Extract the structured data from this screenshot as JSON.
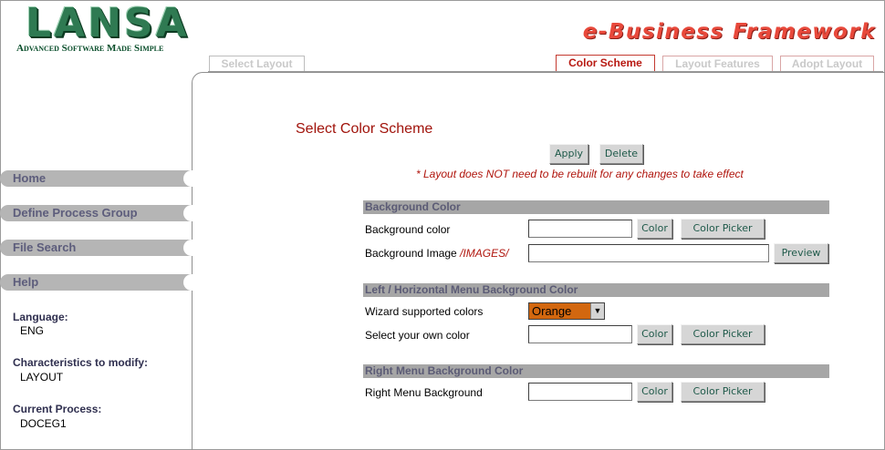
{
  "header": {
    "logo_text": "LANSA",
    "logo_tagline": "Advanced Software Made Simple",
    "framework_title": "e-Business Framework"
  },
  "tabs": [
    {
      "label": "Select Layout",
      "active": false
    },
    {
      "label": "Color Scheme",
      "active": true
    },
    {
      "label": "Layout Features",
      "active": false
    },
    {
      "label": "Adopt Layout",
      "active": false
    }
  ],
  "sidebar": {
    "nav": [
      "Home",
      "Define Process Group",
      "File Search",
      "Help"
    ],
    "info": [
      {
        "label": "Language:",
        "value": "ENG"
      },
      {
        "label": "Characteristics to modify:",
        "value": "LAYOUT"
      },
      {
        "label": "Current Process:",
        "value": "DOCEG1"
      }
    ]
  },
  "main": {
    "title": "Select Color Scheme",
    "apply_label": "Apply",
    "delete_label": "Delete",
    "note": "* Layout does NOT need to be rebuilt for any changes to take effect",
    "sections": [
      {
        "title": "Background Color",
        "rows": [
          {
            "label": "Background color",
            "value": "",
            "buttons": [
              "Color",
              "Color Picker"
            ]
          },
          {
            "label": "Background Image",
            "path": "/IMAGES/",
            "value": "",
            "buttons": [
              "Preview"
            ]
          }
        ]
      },
      {
        "title": "Left / Horizontal Menu Background Color",
        "rows": [
          {
            "label": "Wizard supported colors",
            "selected": "Orange"
          },
          {
            "label": "Select your own color",
            "value": "",
            "buttons": [
              "Color",
              "Color Picker"
            ]
          }
        ]
      },
      {
        "title": "Right Menu Background Color",
        "rows": [
          {
            "label": "Right Menu Background",
            "value": "",
            "buttons": [
              "Color",
              "Color Picker"
            ]
          }
        ]
      }
    ]
  },
  "colors": {
    "accent_red": "#b0150d",
    "selected_orange": "#d2670f",
    "section_gray": "#a6a6a6"
  }
}
